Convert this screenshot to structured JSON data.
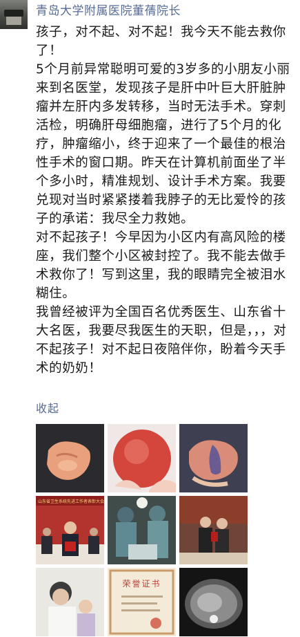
{
  "author": "青岛大学附属医院董蒨院长",
  "post": {
    "paragraphs": [
      "孩子，对不起、对不起！我今天不能去救你了！",
      "5个月前异常聪明可爱的3岁多的小朋友小丽来到名医堂，发现孩子是肝中叶巨大肝脏肿瘤并左肝内多发转移，当时无法手术。穿刺活检，明确肝母细胞瘤，进行了5个月的化疗，肿瘤缩小，终于迎来了一个最佳的根治性手术的窗口期。昨天在计算机前面坐了半个多小时，精准规划、设计手术方案。我要兑现对当时紧紧搂着我脖子的无比爱怜的孩子的承诺：我尽全力救她。",
      "对不起孩子！今早因为小区内有高风险的楼座，我们整个小区被封控了。我不能去做手术救你了！写到这里，我的眼睛完全被泪水糊住。",
      "我曾经被评为全国百名优秀医生、山东省十大名医，我要尽我医生的天职，但是，，，对不起孩子！对不起日夜陪伴你，盼着今天手术的奶奶！"
    ]
  },
  "collapse_label": "收起",
  "photos": [
    {
      "name": "photo-liver-specimen-dark"
    },
    {
      "name": "photo-tumor-in-hands"
    },
    {
      "name": "photo-liver-specimen-blue"
    },
    {
      "name": "photo-award-ceremony",
      "banner_text": "山东省卫生系统先进工作者表彰大会"
    },
    {
      "name": "photo-surgery-team"
    },
    {
      "name": "photo-award-stage"
    },
    {
      "name": "photo-doctor-with-child"
    },
    {
      "name": "photo-honor-certificate",
      "cert_text": "荣誉证书"
    },
    {
      "name": "photo-ct-scan"
    }
  ],
  "colors": {
    "link": "#576b95",
    "text": "#1a1a1a"
  }
}
